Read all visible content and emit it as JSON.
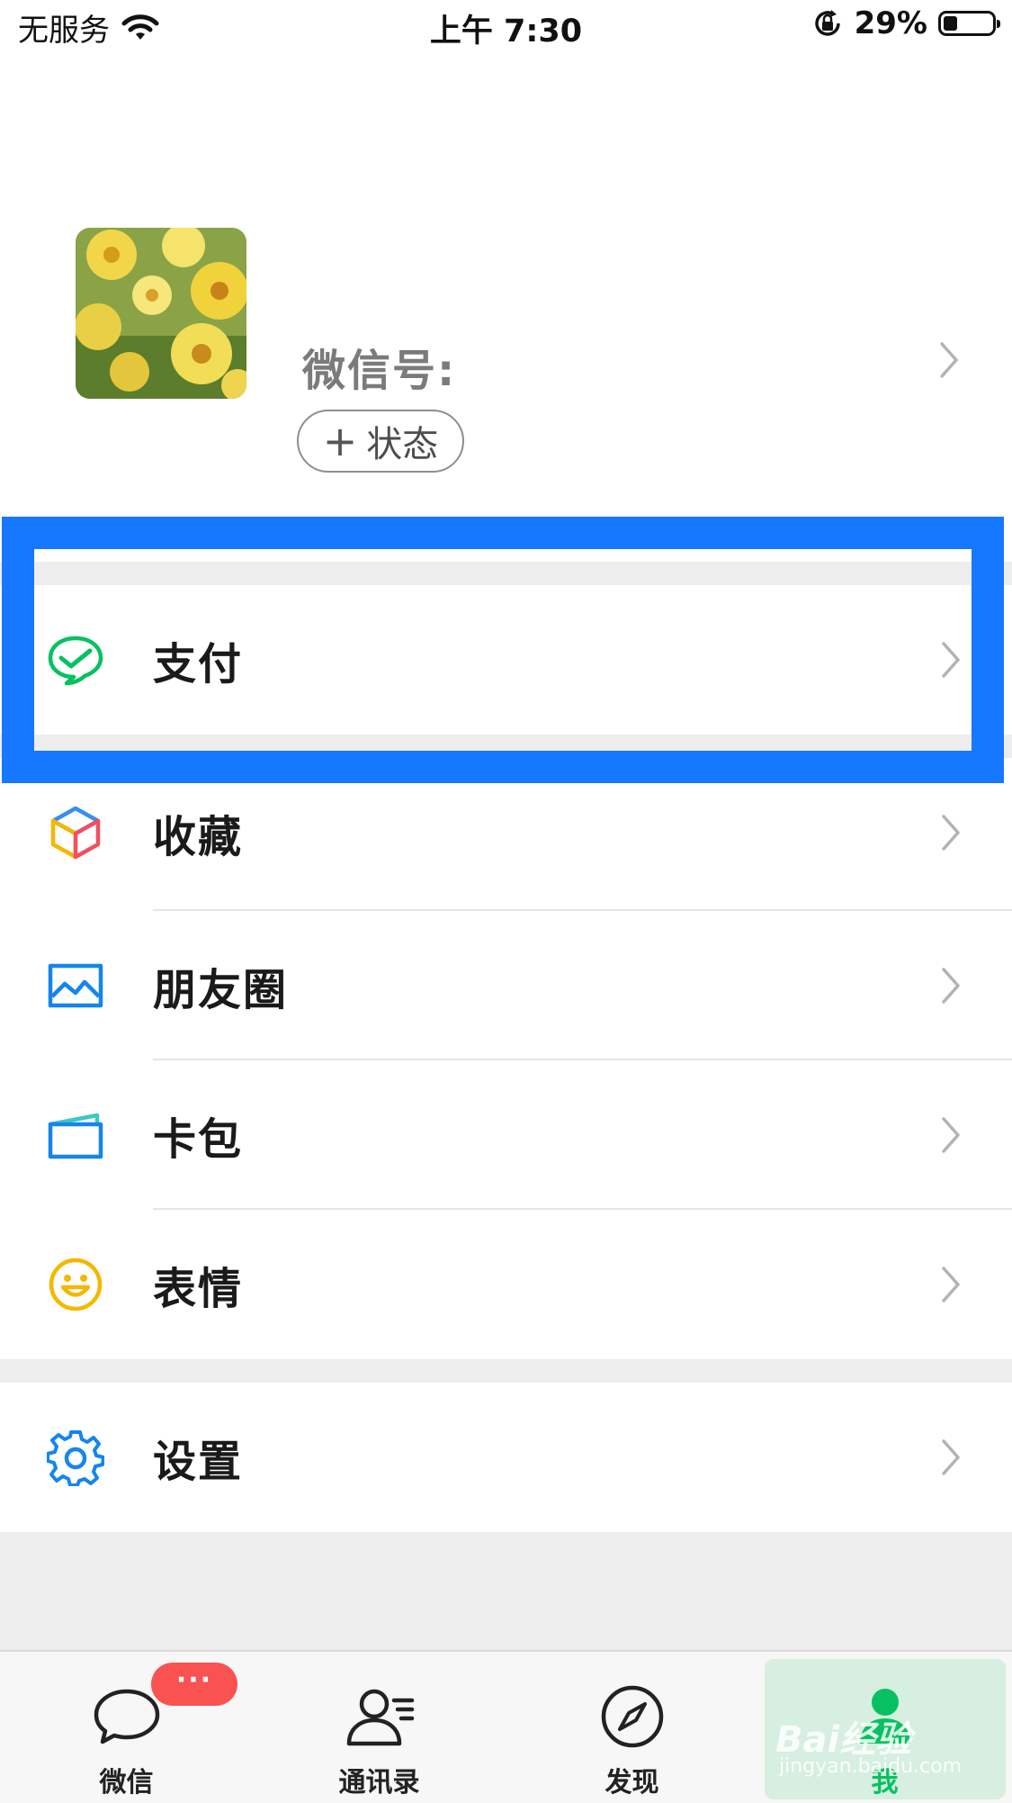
{
  "status_bar": {
    "carrier": "无服务",
    "time": "上午 7:30",
    "battery": "29%",
    "battery_level": 0.29
  },
  "profile": {
    "wechat_id_label": "微信号:",
    "status_button": "状态"
  },
  "menu": {
    "pay": "支付",
    "favorites": "收藏",
    "moments": "朋友圈",
    "cards": "卡包",
    "stickers": "表情",
    "settings": "设置"
  },
  "tabbar": {
    "chats": "微信",
    "chats_badge": "···",
    "contacts": "通讯录",
    "discover": "发现",
    "me": "我"
  },
  "watermark": {
    "brand": "Bai经验",
    "url": "jingyan.baidu.com"
  },
  "colors": {
    "wechat_green": "#07c160",
    "highlight_blue": "#1677ff",
    "badge_red": "#fa5151",
    "icon_blue": "#1485ee"
  },
  "icons": {
    "wifi": "wifi-icon",
    "rotation_lock": "rotation-lock-icon",
    "pay": "pay-check-bubble-icon",
    "favorites": "cube-icon",
    "moments": "picture-icon",
    "cards": "card-wallet-icon",
    "stickers": "smiley-icon",
    "settings": "gear-icon"
  }
}
